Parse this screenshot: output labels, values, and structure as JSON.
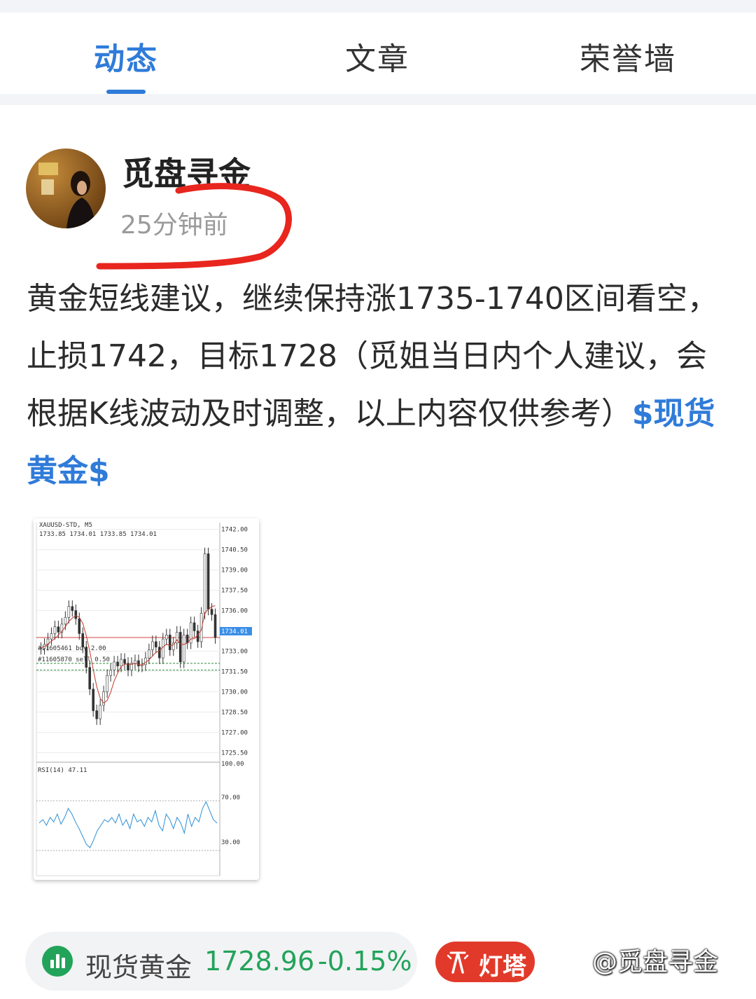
{
  "tabs": [
    {
      "label": "动态",
      "active": true
    },
    {
      "label": "文章",
      "active": false
    },
    {
      "label": "荣誉墙",
      "active": false
    }
  ],
  "post": {
    "username": "觅盘寻金",
    "time": "25分钟前",
    "text": "黄金短线建议，继续保持涨1735-1740区间看空，止损1742，目标1728（觅姐当日内个人建议，会根据K线波动及时调整，以上内容仅供参考）",
    "tag": "$现货黄金$"
  },
  "chart": {
    "symbol_line": "XAUUSD-STD, M5",
    "ohlc_line": "1733.85 1734.01 1733.85 1734.01",
    "order_buy": "#11605461 buy 2.00",
    "order_sell": "#11605870 sell 0.50",
    "price_tag": "1734.01",
    "rsi_label": "RSI(14) 47.11",
    "price_ticks": [
      "1742.00",
      "1740.50",
      "1739.00",
      "1737.50",
      "1736.00",
      "1733.00",
      "1731.50",
      "1730.00",
      "1728.50",
      "1727.00",
      "1725.50"
    ],
    "rsi_ticks": [
      "100.00",
      "70.00",
      "30.00"
    ]
  },
  "chart_data": {
    "type": "line",
    "title": "XAUUSD-STD, M5",
    "ylim": [
      1725,
      1742.5
    ],
    "close": [
      1733.2,
      1733.5,
      1733.9,
      1734.3,
      1734.8,
      1734.4,
      1735.0,
      1735.5,
      1736.3,
      1736.0,
      1735.4,
      1734.3,
      1733.3,
      1731.8,
      1730.2,
      1728.6,
      1728.0,
      1729.0,
      1730.0,
      1731.2,
      1731.6,
      1732.2,
      1731.9,
      1732.4,
      1732.1,
      1731.6,
      1732.1,
      1732.3,
      1731.9,
      1732.0,
      1732.5,
      1733.1,
      1733.7,
      1733.3,
      1732.5,
      1733.9,
      1734.2,
      1733.1,
      1733.6,
      1734.4,
      1732.2,
      1734.2,
      1733.6,
      1735.1,
      1734.5,
      1733.7,
      1735.8,
      1740.2,
      1736.1,
      1735.7,
      1734.0
    ],
    "rsi": [
      47,
      50,
      45,
      52,
      48,
      55,
      46,
      52,
      60,
      55,
      48,
      42,
      35,
      28,
      25,
      32,
      40,
      45,
      50,
      48,
      52,
      47,
      55,
      45,
      50,
      42,
      55,
      48,
      50,
      44,
      52,
      48,
      58,
      45,
      40,
      55,
      50,
      42,
      52,
      47,
      38,
      55,
      44,
      52,
      48,
      60,
      66,
      58,
      50,
      47
    ],
    "rsi_ylim": [
      0,
      100
    ],
    "levels": {
      "buy": 1732.1,
      "sell": 1731.6,
      "current": 1734.01
    }
  },
  "quote": {
    "name": "现货黄金",
    "price": "1728.96",
    "change": "-0.15%"
  },
  "lighthouse_label": "灯塔",
  "watermark": "@觅盘寻金"
}
